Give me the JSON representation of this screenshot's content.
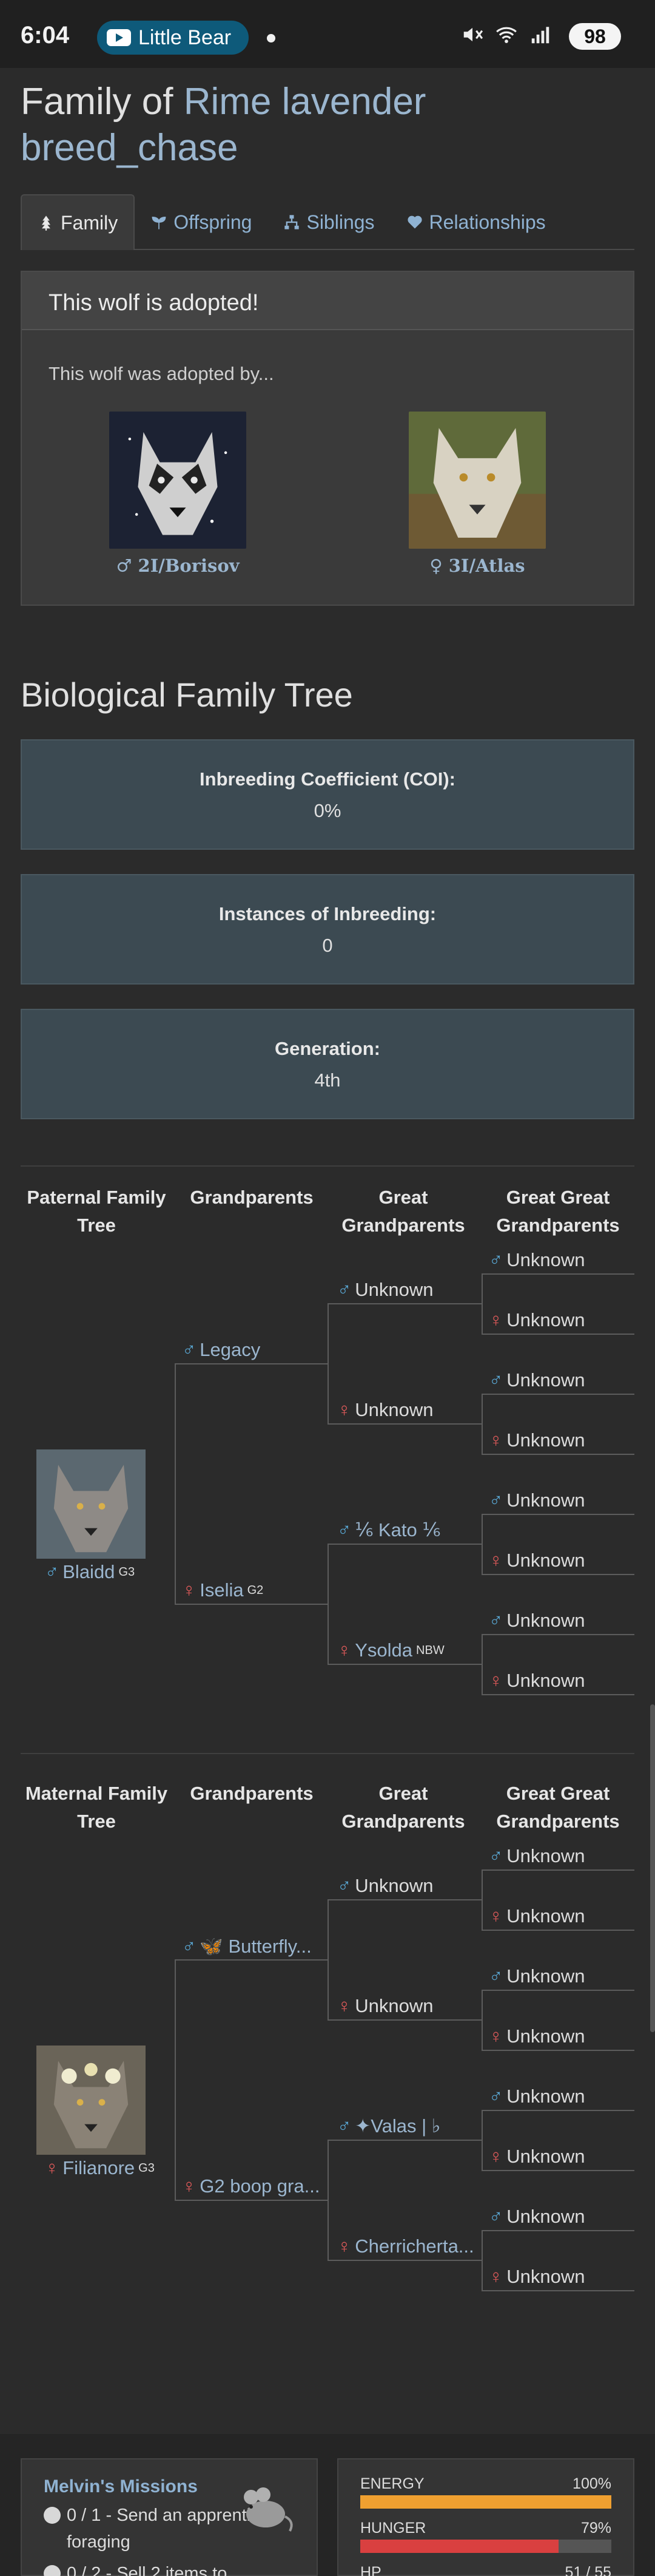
{
  "status_bar": {
    "time": "6:04",
    "pill_label": "Little Bear",
    "battery": "98"
  },
  "page": {
    "title_prefix": "Family of ",
    "title_link_line1": "Rime lavender",
    "title_link_line2": "breed_chase"
  },
  "tabs": [
    {
      "label": "Family",
      "icon": "tree-icon"
    },
    {
      "label": "Offspring",
      "icon": "sprout-icon"
    },
    {
      "label": "Siblings",
      "icon": "sitemap-icon"
    },
    {
      "label": "Relationships",
      "icon": "heart-icon"
    }
  ],
  "adoption": {
    "heading": "This wolf is adopted!",
    "subtext": "This wolf was adopted by...",
    "adopters": [
      {
        "symbol": "♂",
        "name": "2I/Borisov"
      },
      {
        "symbol": "♀",
        "name": "3I/Atlas"
      }
    ]
  },
  "bio": {
    "title": "Biological Family Tree",
    "coi_label": "Inbreeding Coefficient (COI):",
    "coi_value": "0%",
    "instances_label": "Instances of Inbreeding:",
    "instances_value": "0",
    "generation_label": "Generation:",
    "generation_value": "4th"
  },
  "tree_headers": {
    "grandparents": "Grandparents",
    "great": "Great Grandparents",
    "great_great": "Great Great Grandparents"
  },
  "paternal": {
    "header": "Paternal Family Tree",
    "parent": {
      "symbol": "♂",
      "name": "Blaidd",
      "sup": "G3"
    },
    "grandparents": [
      {
        "symbol": "♂",
        "name": "Legacy",
        "sup": ""
      },
      {
        "symbol": "♀",
        "name": "Iselia",
        "sup": "G2"
      }
    ],
    "great": [
      {
        "symbol": "♂",
        "name": "Unknown",
        "sup": ""
      },
      {
        "symbol": "♀",
        "name": "Unknown",
        "sup": ""
      },
      {
        "symbol": "♂",
        "name": "⅙ Kato ⅙",
        "sup": ""
      },
      {
        "symbol": "♀",
        "name": "Ysolda",
        "sup": "NBW"
      }
    ],
    "great_great": [
      "♂ Unknown",
      "♀ Unknown",
      "♂ Unknown",
      "♀ Unknown",
      "♂ Unknown",
      "♀ Unknown",
      "♂ Unknown",
      "♀ Unknown"
    ]
  },
  "maternal": {
    "header": "Maternal Family Tree",
    "parent": {
      "symbol": "♀",
      "name": "Filianore",
      "sup": "G3"
    },
    "grandparents": [
      {
        "symbol": "♂",
        "name": "🦋 Butterfly...",
        "sup": ""
      },
      {
        "symbol": "♀",
        "name": "G2 boop gra...",
        "sup": ""
      }
    ],
    "great": [
      {
        "symbol": "♂",
        "name": "Unknown",
        "sup": ""
      },
      {
        "symbol": "♀",
        "name": "Unknown",
        "sup": ""
      },
      {
        "symbol": "♂",
        "name": "✦Valas | ♭",
        "sup": ""
      },
      {
        "symbol": "♀",
        "name": "Cherricherta...",
        "sup": ""
      }
    ],
    "great_great": [
      "♂ Unknown",
      "♀ Unknown",
      "♂ Unknown",
      "♀ Unknown",
      "♂ Unknown",
      "♀ Unknown",
      "♂ Unknown",
      "♀ Unknown"
    ]
  },
  "missions": {
    "title": "Melvin's Missions",
    "items": [
      "0 / 1 - Send an apprentice foraging",
      "0 / 2 - Sell 2 items to"
    ]
  },
  "meters": [
    {
      "label": "ENERGY",
      "value": "100%",
      "level": 100,
      "color": "#f0a030"
    },
    {
      "label": "HUNGER",
      "value": "79%",
      "level": 79,
      "color": "#d94040"
    },
    {
      "label": "HP",
      "value": "51 / 55",
      "level": 93,
      "color": "#4caf50"
    }
  ]
}
